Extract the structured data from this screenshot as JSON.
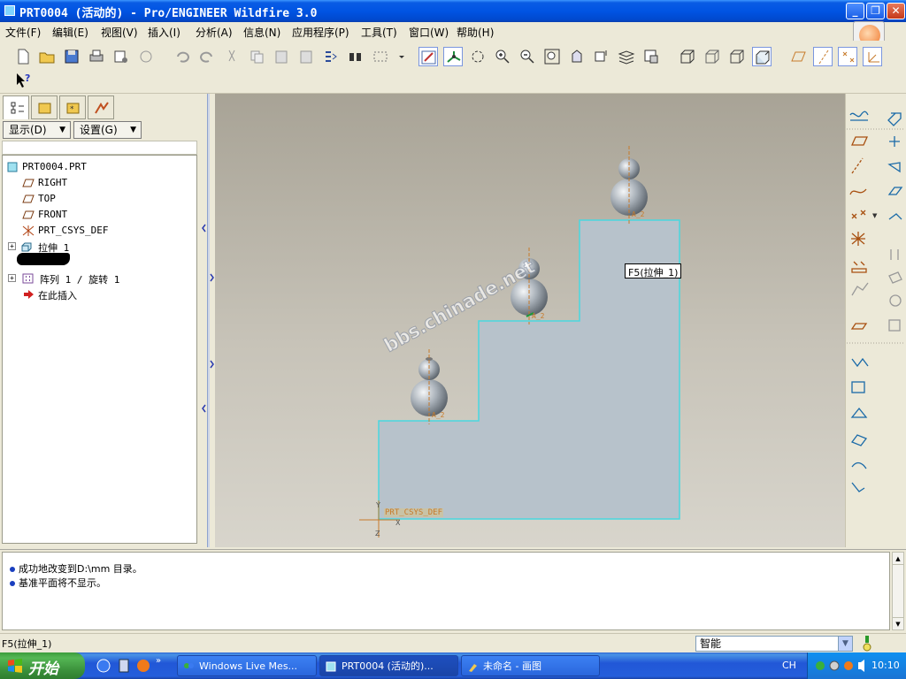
{
  "window": {
    "title": "PRT0004 (活动的) - Pro/ENGINEER Wildfire 3.0",
    "min": "_",
    "max": "❐",
    "close": "✕"
  },
  "menu": [
    "文件(F)",
    "编辑(E)",
    "视图(V)",
    "插入(I)",
    "分析(A)",
    "信息(N)",
    "应用程序(P)",
    "工具(T)",
    "窗口(W)",
    "帮助(H)"
  ],
  "left_panel": {
    "show_button": "显示(D)",
    "settings_button": "设置(G)",
    "tree": [
      {
        "label": "PRT0004.PRT"
      },
      {
        "label": "RIGHT"
      },
      {
        "label": "TOP"
      },
      {
        "label": "FRONT"
      },
      {
        "label": "PRT_CSYS_DEF"
      },
      {
        "label": "拉伸 1"
      },
      {
        "label": ""
      },
      {
        "label": "阵列 1 / 旋转 1"
      },
      {
        "label": "在此插入"
      }
    ]
  },
  "viewport": {
    "tooltip": "F5(拉伸_1)",
    "csys_label": "PRT_CSYS_DEF",
    "watermark": "bbs.chinade.net",
    "axis_tag": "A_2"
  },
  "messages": [
    "成功地改变到D:\\mm 目录。",
    "基准平面将不显示。"
  ],
  "status": {
    "text": "F5(拉伸_1)",
    "filter": "智能"
  },
  "taskbar": {
    "start": "开始",
    "tasks": [
      "Windows Live Mes...",
      "PRT0004 (活动的)...",
      "未命名 - 画图"
    ],
    "lang": "CH",
    "time": "10:10"
  },
  "colors": {
    "xp_blue": "#0054e3",
    "model_fill": "#b8c3cc",
    "model_edge": "#49d8e0",
    "datum_orange": "#c77a2a"
  }
}
